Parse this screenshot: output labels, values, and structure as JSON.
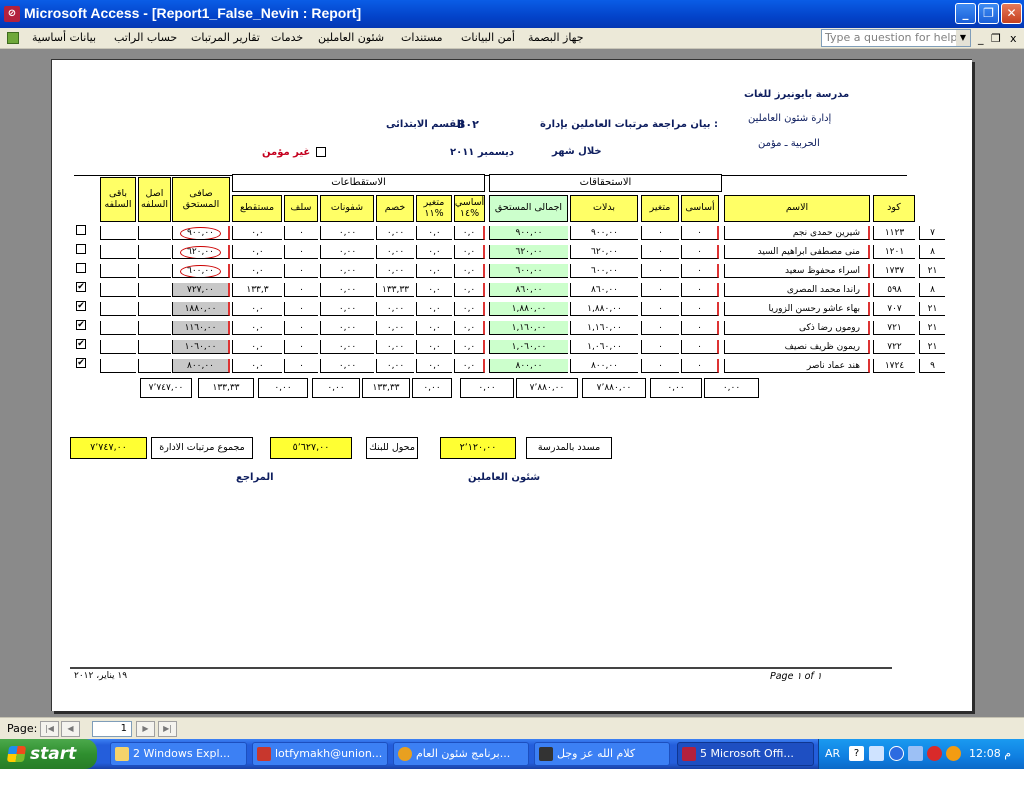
{
  "window": {
    "title": "Microsoft Access - [Report1_False_Nevin : Report]",
    "buttons": {
      "minimize": "_",
      "restore": "❐",
      "close": "✕"
    }
  },
  "menu": {
    "items": [
      "بيانات أساسية",
      "حساب الراتب",
      "تقارير المرتبات",
      "خدمات",
      "شئون العاملين",
      "مستندات",
      "أمن البيانات",
      "جهاز البصمة"
    ],
    "help_placeholder": "Type a question for help",
    "mdi": {
      "min": "_",
      "restore": "❐",
      "close": "x"
    }
  },
  "report": {
    "school": "مدرسة بايونيرز للغات",
    "dept": "إدارة شئون العاملين",
    "city": "الحربية ـ مؤمن",
    "statement": "بيان مراجعة مرتبات العاملين بإدارة :",
    "section_code": "B٠٢",
    "section_name": "القسم الابتدائى",
    "period_label": "خلال شهر",
    "period": "ديسمبر ٢٠١١",
    "uninsured_label": "غير مؤمن",
    "groups": {
      "deductions": "الاستقطاعات",
      "entitlements": "الاستحقاقات"
    },
    "headers": {
      "remaining_loan": "باقى السلفه",
      "loan_principal": "اصل السلفه",
      "net": "صافى المستحق",
      "deducted": "مستقطع",
      "advances": "سلف",
      "withdrawals": "شفونات",
      "discount": "خصم",
      "var11": "متغير ١١%",
      "basic14": "أساسي ١٤%",
      "total": "اجمالى المستحق",
      "allowances": "بدلات",
      "variable": "متغير",
      "basic": "أساسى",
      "name": "الاسم",
      "code": "كود"
    },
    "rows": [
      {
        "checked": false,
        "net": "٩٠٠,٠٠",
        "deducted": "٠,٠",
        "adv": "٠",
        "wd": "٠,٠٠",
        "disc": "٠,٠٠",
        "v11": "٠,٠",
        "b14": "٠,٠",
        "total": "٩٠٠,٠٠",
        "allow": "٩٠٠,٠٠",
        "var": "٠",
        "basic": "٠",
        "name": "شيرين حمدى نجم",
        "code": "١١٢٣",
        "grp": "٧"
      },
      {
        "checked": false,
        "net": "٦٢٠,٠٠",
        "deducted": "٠,٠",
        "adv": "٠",
        "wd": "٠,٠٠",
        "disc": "٠,٠٠",
        "v11": "٠,٠",
        "b14": "٠,٠",
        "total": "٦٢٠,٠٠",
        "allow": "٦٢٠,٠٠",
        "var": "٠",
        "basic": "٠",
        "name": "منى مصطفى ابراهيم السيد",
        "code": "١٢٠١",
        "grp": "٨"
      },
      {
        "checked": false,
        "net": "٦٠٠,٠٠",
        "deducted": "٠,٠",
        "adv": "٠",
        "wd": "٠,٠٠",
        "disc": "٠,٠٠",
        "v11": "٠,٠",
        "b14": "٠,٠",
        "total": "٦٠٠,٠٠",
        "allow": "٦٠٠,٠٠",
        "var": "٠",
        "basic": "٠",
        "name": "اسراء محفوظ سعيد",
        "code": "١٧٣٧",
        "grp": "٢١"
      },
      {
        "checked": true,
        "net": "٧٢٧,٠٠",
        "deducted": "١٣٣,٣",
        "adv": "٠",
        "wd": "٠,٠٠",
        "disc": "١٣٣,٣٣",
        "v11": "٠,٠",
        "b14": "٠,٠",
        "total": "٨٦٠,٠٠",
        "allow": "٨٦٠,٠٠",
        "var": "٠",
        "basic": "٠",
        "name": "راندا محمد المصرى",
        "code": "٥٩٨",
        "grp": "٨"
      },
      {
        "checked": true,
        "net": "١٨٨٠,٠٠",
        "deducted": "٠,٠",
        "adv": "٠",
        "wd": "٠,٠٠",
        "disc": "٠,٠٠",
        "v11": "٠,٠",
        "b14": "٠,٠",
        "total": "١,٨٨٠,٠٠",
        "allow": "١,٨٨٠,٠٠",
        "var": "٠",
        "basic": "٠",
        "name": "بهاء عاشو رحسن الزوريا",
        "code": "٧٠٧",
        "grp": "٢١"
      },
      {
        "checked": true,
        "net": "١١٦٠,٠٠",
        "deducted": "٠,٠",
        "adv": "٠",
        "wd": "٠,٠٠",
        "disc": "٠,٠٠",
        "v11": "٠,٠",
        "b14": "٠,٠",
        "total": "١,١٦٠,٠٠",
        "allow": "١,١٦٠,٠٠",
        "var": "٠",
        "basic": "٠",
        "name": "روموں رضا ذكى",
        "code": "٧٢١",
        "grp": "٢١"
      },
      {
        "checked": true,
        "net": "١٠٦٠,٠٠",
        "deducted": "٠,٠",
        "adv": "٠",
        "wd": "٠,٠٠",
        "disc": "٠,٠٠",
        "v11": "٠,٠",
        "b14": "٠,٠",
        "total": "١,٠٦٠,٠٠",
        "allow": "١,٠٦٠,٠٠",
        "var": "٠",
        "basic": "٠",
        "name": "ريمون ظريف نصيف",
        "code": "٧٢٢",
        "grp": "٢١"
      },
      {
        "checked": true,
        "net": "٨٠٠,٠٠",
        "deducted": "٠,٠",
        "adv": "٠",
        "wd": "٠,٠٠",
        "disc": "٠,٠٠",
        "v11": "٠,٠",
        "b14": "٠,٠",
        "total": "٨٠٠,٠٠",
        "allow": "٨٠٠,٠٠",
        "var": "٠",
        "basic": "٠",
        "name": "هند عماد ناصر",
        "code": "١٧٢٤",
        "grp": "٩"
      }
    ],
    "totals": [
      "٧٬٧٤٧,٠٠",
      "١٣٣,٣٣",
      "٠,٠٠",
      "٠,٠٠",
      "١٣٣,٣٣",
      "٠,٠٠",
      "٠,٠٠",
      "٧٬٨٨٠,٠٠",
      "٧٬٨٨٠,٠٠",
      "٠,٠٠",
      "٠,٠٠"
    ],
    "summary": {
      "total_value": "٧٬٧٤٧,٠٠",
      "total_label": "مجموع مرتبات الادارة",
      "bank_value": "٥٬٦٢٧,٠٠",
      "bank_label": "محول للبنك",
      "school_value": "٢٬١٢٠,٠٠",
      "school_label": "مسدد بالمدرسة",
      "reviewer": "المراجع",
      "hr": "شئون العاملين"
    },
    "footer": {
      "page": "Page ١ of ١",
      "date": "١٩ يناير، ٢٠١٢"
    }
  },
  "statusbar": {
    "page_label": "Page:",
    "page_value": "1"
  },
  "taskbar": {
    "start": "start",
    "tasks": [
      "2 Windows Expl...",
      "lotfymakh@union...",
      "برنامج شئون العام...",
      "كلام الله عز وجل",
      "5 Microsoft Offi..."
    ],
    "lang": "AR",
    "clock": "12:08 م"
  }
}
